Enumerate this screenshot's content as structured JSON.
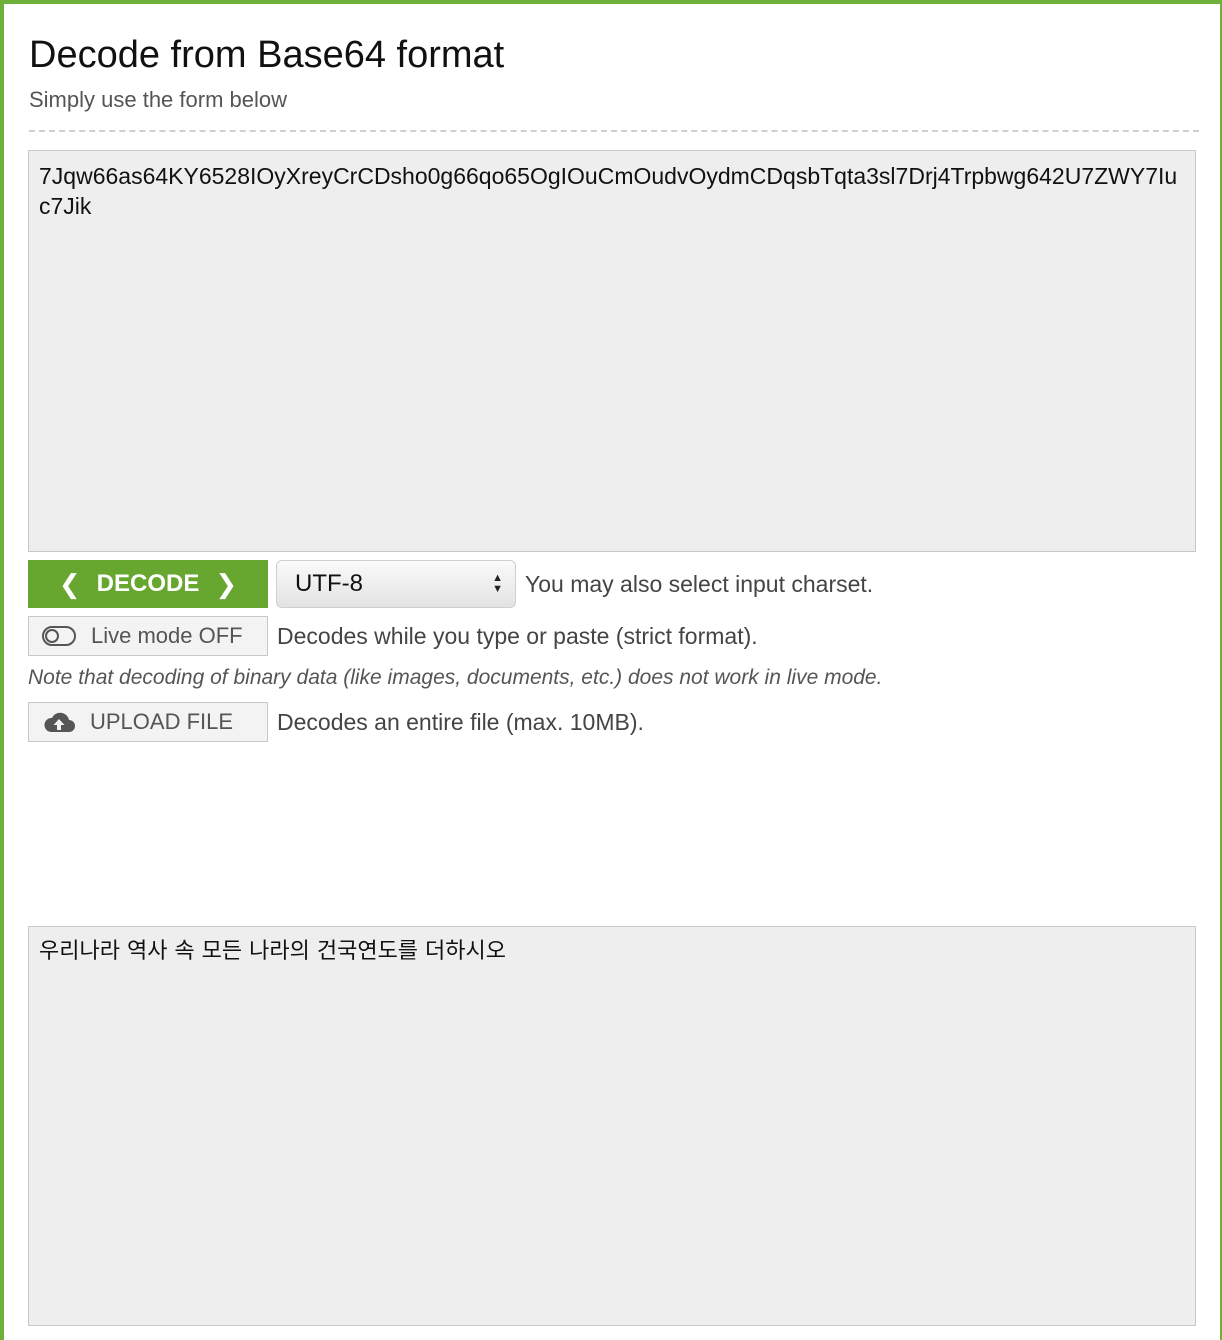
{
  "header": {
    "title": "Decode from Base64 format",
    "subtitle": "Simply use the form below"
  },
  "input": {
    "value": "7Jqw66as64KY6528IOyXreyCrCDsho0g66qo65OgIOuCmOudvOydmCDqsbTqta3sl7Drj4Trpbwg642U7ZWY7Iuc7Jik"
  },
  "decode": {
    "button_label": "DECODE",
    "charset_value": "UTF-8",
    "charset_help": "You may also select input charset."
  },
  "live_mode": {
    "button_label": "Live mode OFF",
    "help": "Decodes while you type or paste (strict format).",
    "note": "Note that decoding of binary data (like images, documents, etc.) does not work in live mode."
  },
  "upload": {
    "button_label": "UPLOAD FILE",
    "help": "Decodes an entire file (max. 10MB)."
  },
  "output": {
    "value": "우리나라 역사 속 모든 나라의 건국연도를 더하시오"
  },
  "colors": {
    "accent": "#67a72f",
    "frame": "#6fb03a",
    "field_bg": "#eeeeee"
  }
}
